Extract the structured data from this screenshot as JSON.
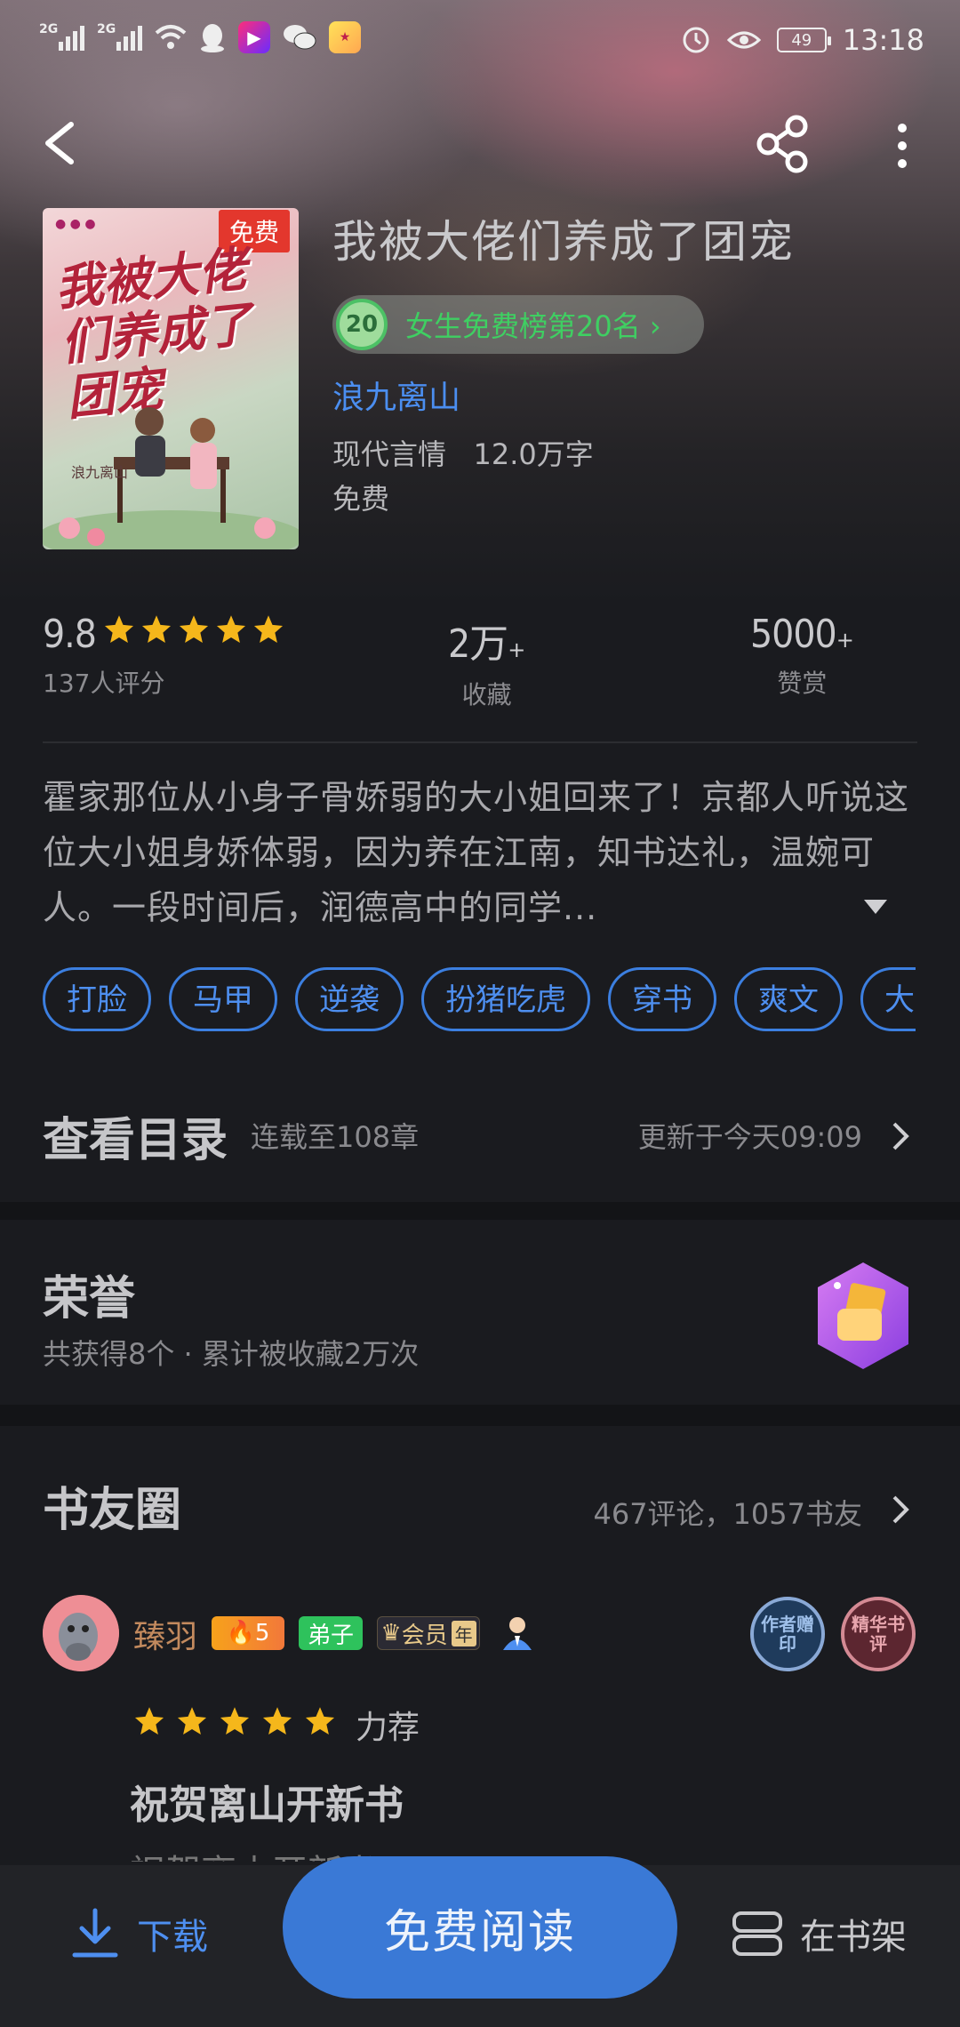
{
  "status_bar": {
    "net1": "2G",
    "net2": "2G",
    "battery": "49",
    "time": "13:18",
    "icons": [
      "signal-icon",
      "signal-icon",
      "wifi-icon",
      "qq-icon",
      "video-app-icon",
      "wechat-icon",
      "game-app-icon",
      "alarm-icon",
      "eye-comfort-icon",
      "battery-icon"
    ]
  },
  "nav": {
    "back_icon": "chevron-left-icon",
    "share_icon": "share-icon",
    "more_icon": "more-vertical-icon"
  },
  "book": {
    "cover_tag": "免费",
    "cover_title": "我被大佬们养成了团宠",
    "cover_author": "浪九离山",
    "title": "我被大佬们养成了团宠",
    "rank_number": "20",
    "rank_text": "女生免费榜第20名 ›",
    "author": "浪九离山",
    "genre_words": "现代言情   12.0万字",
    "price": "免费"
  },
  "stats": {
    "score": "9.8",
    "star_count": 5,
    "rating_count": "137人评分",
    "favorites_value": "2万",
    "favorites_plus": "+",
    "favorites_label": "收藏",
    "rewards_value": "5000",
    "rewards_plus": "+",
    "rewards_label": "赞赏"
  },
  "synopsis": "霍家那位从小身子骨娇弱的大小姐回来了！京都人听说这位大小姐身娇体弱，因为养在江南，知书达礼，温婉可人。一段时间后，润德高中的同学...",
  "tags": [
    "打脸",
    "马甲",
    "逆袭",
    "扮猪吃虎",
    "穿书",
    "爽文",
    "大佬"
  ],
  "catalog": {
    "title": "查看目录",
    "progress": "连载至108章",
    "updated": "更新于今天09:09"
  },
  "honor": {
    "title": "荣誉",
    "summary": "共获得8个 · 累计被收藏2万次"
  },
  "circle": {
    "title": "书友圈",
    "counts": "467评论，1057书友",
    "review": {
      "username": "臻羽",
      "fan_level": "5",
      "disciple_badge": "弟子",
      "member_badge": "会员",
      "member_year": "年",
      "seal_author": "作者赠印",
      "seal_elite": "精华书评",
      "stars": 5,
      "recommend": "力荐",
      "title": "祝贺离山开新书",
      "peek": "祝贺离山开新书"
    }
  },
  "bottom": {
    "download": "下载",
    "read": "免费阅读",
    "shelf": "在书架"
  },
  "colors": {
    "accent": "#3a79d6",
    "link": "#4e8ff0",
    "rank_green": "#3fcf62",
    "star": "#f5b71b",
    "background": "#1a1b1f"
  }
}
